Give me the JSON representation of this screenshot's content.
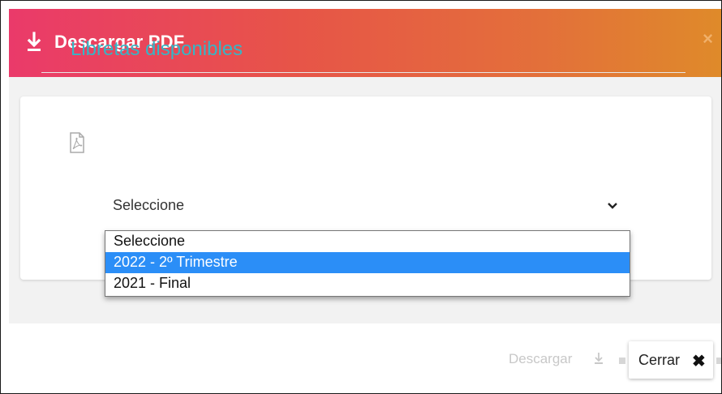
{
  "modal": {
    "title": "Descargar PDF",
    "close_glyph": "×",
    "header_gradient": [
      "#ea3a6a",
      "#df8a2a"
    ]
  },
  "panel": {
    "title": "Libretas disponibles",
    "title_color": "#36b5c6"
  },
  "select": {
    "value": "Seleccione",
    "options": [
      {
        "label": "Seleccione",
        "selected": false
      },
      {
        "label": "2022 - 2º Trimestre",
        "selected": true
      },
      {
        "label": "2021 - Final",
        "selected": false
      }
    ],
    "highlight_color": "#2b8ef7"
  },
  "footer": {
    "download_label": "Descargar",
    "close_label": "Cerrar",
    "close_glyph": "✖"
  },
  "icons": [
    "download-icon",
    "pdf-file-icon",
    "chevron-down-icon",
    "close-icon"
  ]
}
